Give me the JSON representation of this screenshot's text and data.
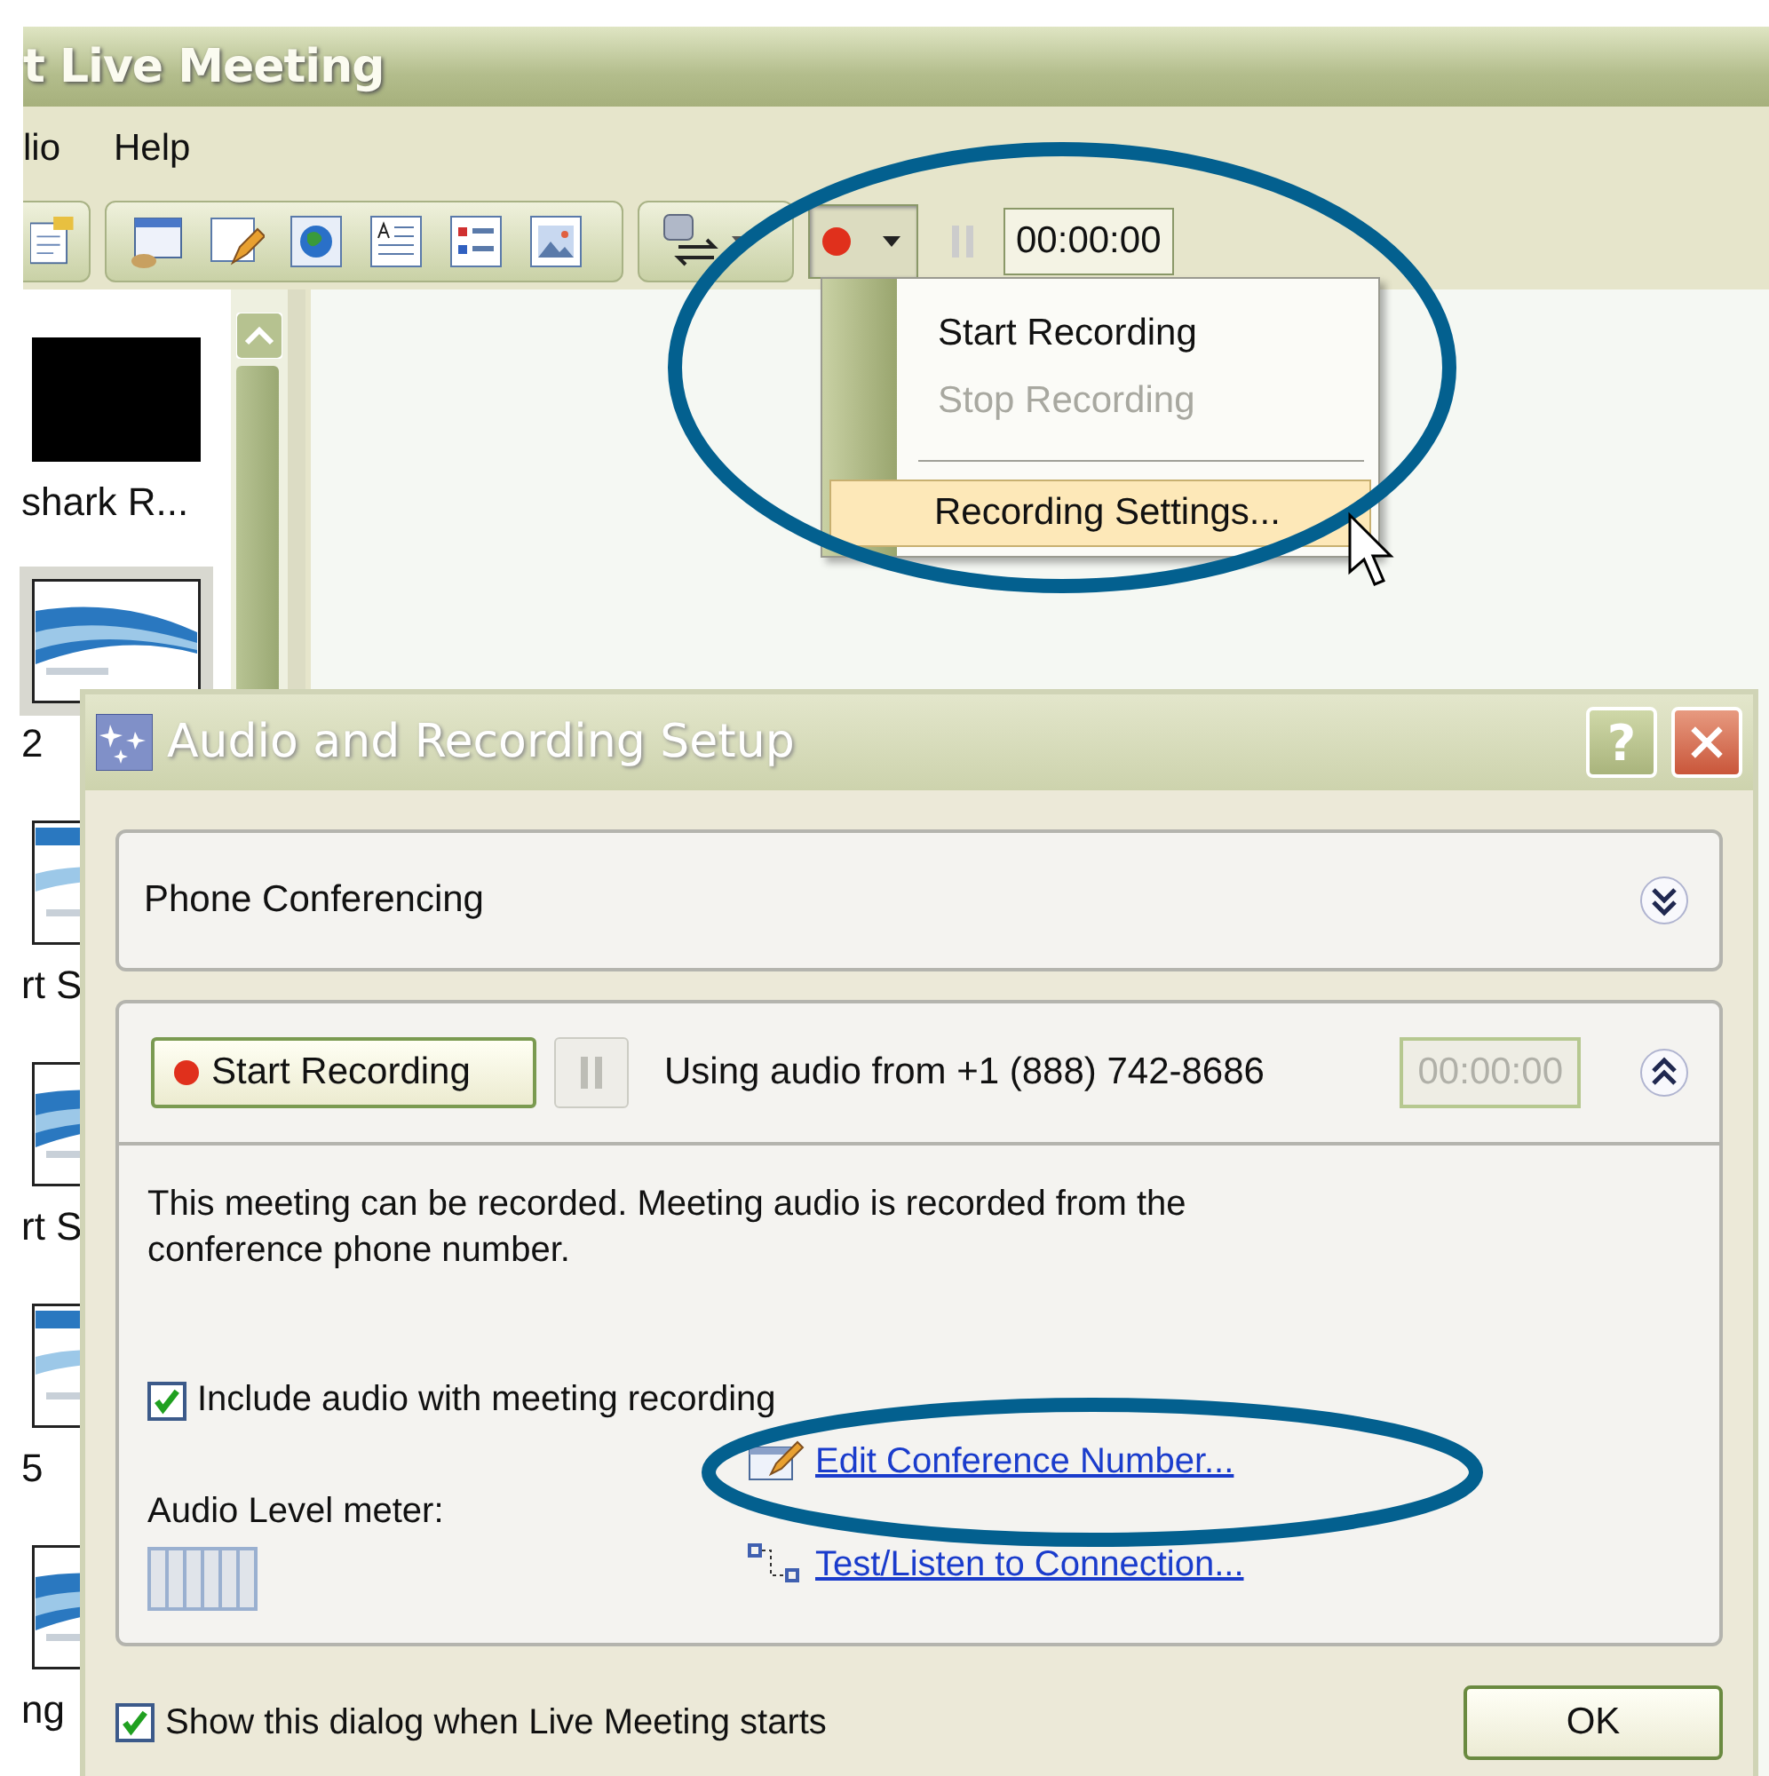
{
  "window": {
    "title": "t Live Meeting"
  },
  "menu_bar": [
    {
      "label": "lio"
    },
    {
      "label": "Help"
    }
  ],
  "toolbar": {
    "timer": "00:00:00",
    "recording_pressed": true
  },
  "slides": [
    {
      "label": "shark R...",
      "selected": false
    },
    {
      "label": "2",
      "selected": true
    },
    {
      "label": "rt S",
      "selected": false
    },
    {
      "label": "rt S",
      "selected": false
    },
    {
      "label": "5",
      "selected": false
    },
    {
      "label": "ng",
      "selected": false
    }
  ],
  "record_menu": {
    "items": [
      {
        "kind": "item",
        "label": "Start Recording",
        "disabled": false,
        "highlighted": false
      },
      {
        "kind": "item",
        "label": "Stop Recording",
        "disabled": true,
        "highlighted": false
      },
      {
        "kind": "separator"
      },
      {
        "kind": "item",
        "label": "Recording Settings...",
        "disabled": false,
        "highlighted": true
      }
    ]
  },
  "dialog": {
    "title": "Audio and Recording Setup",
    "phone_panel": {
      "title": "Phone Conferencing",
      "expanded": false
    },
    "recording_panel": {
      "expanded": true,
      "start_button": "Start Recording",
      "pause_disabled": true,
      "source": "Using audio from +1 (888) 742-8686",
      "timer": "00:00:00",
      "timer_disabled": true,
      "description": "This meeting can be recorded. Meeting audio is recorded from the conference phone number.",
      "include_audio": {
        "label": "Include audio with meeting recording",
        "checked": true
      },
      "meter": {
        "label": "Audio Level meter:",
        "level": 0
      },
      "links": [
        {
          "kind": "edit",
          "label": "Edit Conference Number..."
        },
        {
          "kind": "test",
          "label": "Test/Listen to Connection..."
        }
      ]
    },
    "show_on_start": {
      "label": "Show this dialog when Live Meeting starts",
      "checked": true
    },
    "help_button": "?",
    "ok_button": "OK"
  }
}
